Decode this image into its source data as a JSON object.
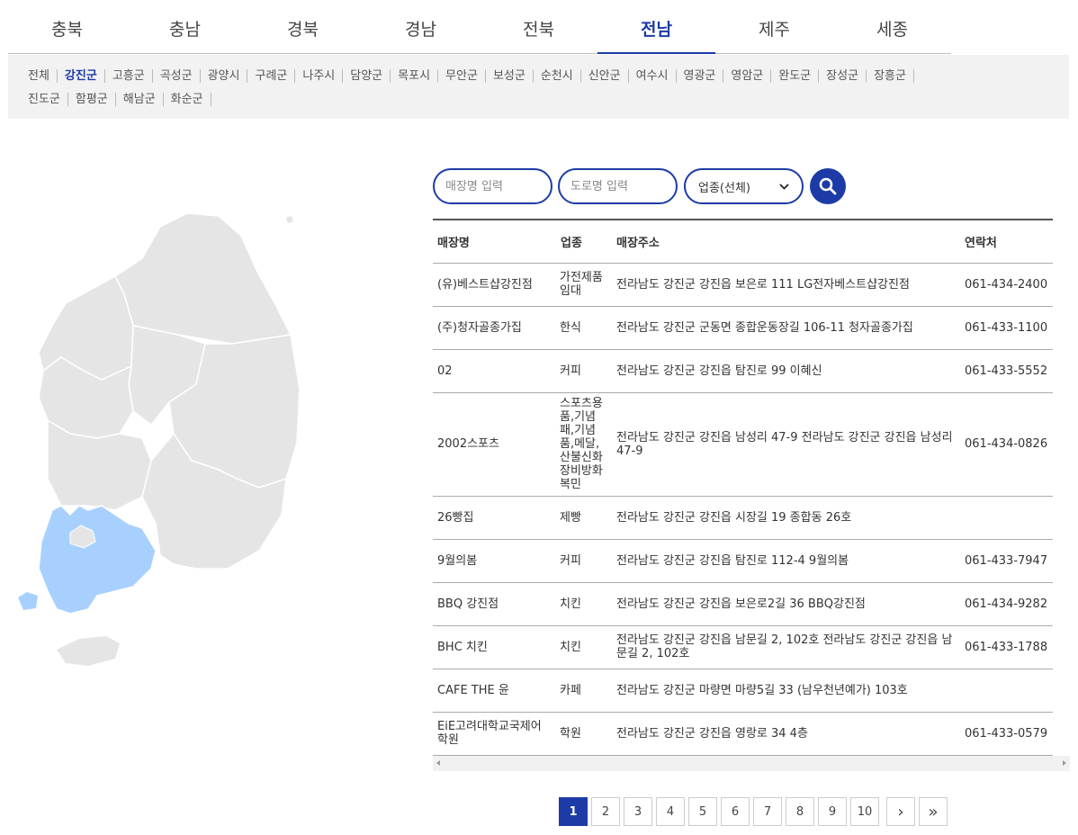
{
  "regions": [
    "충북",
    "충남",
    "경북",
    "경남",
    "전북",
    "전남",
    "제주",
    "세종"
  ],
  "active_region": "전남",
  "districts_row1": [
    "전체",
    "강진군",
    "고흥군",
    "곡성군",
    "광양시",
    "구례군",
    "나주시",
    "담양군",
    "목포시",
    "무안군",
    "보성군",
    "순천시",
    "신안군",
    "여수시",
    "영광군",
    "영암군",
    "완도군",
    "장성군",
    "장흥군"
  ],
  "districts_row2": [
    "진도군",
    "함평군",
    "해남군",
    "화순군"
  ],
  "active_district": "강진군",
  "search": {
    "name_placeholder": "매장명 입력",
    "road_placeholder": "도로명 입력",
    "category_selected": "업종(선체)"
  },
  "table": {
    "headers": [
      "매장명",
      "업종",
      "매장주소",
      "연락처"
    ],
    "rows": [
      {
        "name": "(유)베스트샵강진점",
        "type": "가전제품 임대",
        "address": "전라남도 강진군 강진읍 보은로 111 LG전자베스트샵강진점",
        "phone": "061-434-2400"
      },
      {
        "name": "(주)청자골종가집",
        "type": "한식",
        "address": "전라남도 강진군 군동면 종합운동장길 106-11 청자골종가집",
        "phone": "061-433-1100"
      },
      {
        "name": "02",
        "type": "커피",
        "address": "전라남도 강진군 강진읍 탐진로 99 이혜신",
        "phone": "061-433-5552"
      },
      {
        "name": "2002스포츠",
        "type": "스포츠용품,기념패,기념품,메달,산불신화장비방화복민",
        "address": "전라남도 강진군 강진읍 남성리 47-9 전라남도 강진군 강진읍 남성리 47-9",
        "phone": "061-434-0826"
      },
      {
        "name": "26빵집",
        "type": "제빵",
        "address": "전라남도 강진군 강진읍 시장길 19 종합동 26호",
        "phone": ""
      },
      {
        "name": "9월의봄",
        "type": "커피",
        "address": "전라남도 강진군 강진읍 탐진로 112-4 9월의봄",
        "phone": "061-433-7947"
      },
      {
        "name": "BBQ 강진점",
        "type": "치킨",
        "address": "전라남도 강진군 강진읍 보은로2길 36 BBQ강진점",
        "phone": "061-434-9282"
      },
      {
        "name": "BHC 치킨",
        "type": "치킨",
        "address": "전라남도 강진군 강진읍 남문길 2, 102호 전라남도 강진군 강진읍 남문길 2, 102호",
        "phone": "061-433-1788"
      },
      {
        "name": "CAFE THE 윤",
        "type": "카페",
        "address": "전라남도 강진군 마량면 마량5길 33 (남우천년예가) 103호",
        "phone": ""
      },
      {
        "name": "EiE고려대학교국제어학원",
        "type": "학원",
        "address": "전라남도 강진군 강진읍 영랑로 34 4층",
        "phone": "061-433-0579"
      }
    ]
  },
  "pagination": {
    "pages": [
      "1",
      "2",
      "3",
      "4",
      "5",
      "6",
      "7",
      "8",
      "9",
      "10"
    ],
    "active": "1",
    "next": "›",
    "last": "»"
  },
  "colors": {
    "accent": "#1d3ba6",
    "map_land": "#e5e5e5",
    "map_highlight": "#a8d0ff"
  }
}
